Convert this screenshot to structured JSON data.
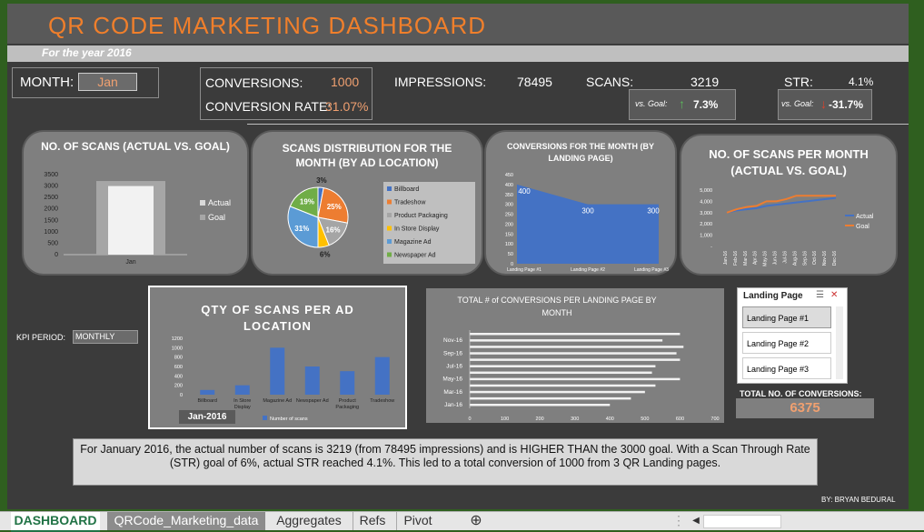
{
  "header": {
    "title": "QR CODE MARKETING DASHBOARD",
    "subtitle": "For the year 2016"
  },
  "kpis": {
    "month_label": "MONTH:",
    "month_value": "Jan",
    "conversions_label": "CONVERSIONS:",
    "conversions_value": "1000",
    "conv_rate_label": "CONVERSION RATE:",
    "conv_rate_value": "31.07%",
    "impressions_label": "IMPRESSIONS:",
    "impressions_value": "78495",
    "scans_label": "SCANS:",
    "scans_value": "3219",
    "scans_goal_label": "vs. Goal:",
    "scans_goal_value": "7.3%",
    "scans_goal_arrow": "↑",
    "str_label": "STR:",
    "str_value": "4.1%",
    "str_goal_label": "vs. Goal:",
    "str_goal_value": "-31.7%",
    "str_goal_arrow": "↓"
  },
  "colors": {
    "orange": "#f07f2b",
    "blue": "#4472c4",
    "green_up": "#5cb85c",
    "red_down": "#e0402a"
  },
  "chart_data": [
    {
      "type": "bar",
      "title": "NO. OF SCANS (ACTUAL VS. GOAL)",
      "categories": [
        "Jan"
      ],
      "series": [
        {
          "name": "Actual",
          "values": [
            3000
          ]
        },
        {
          "name": "Goal",
          "values": [
            3219
          ]
        }
      ],
      "y_ticks": [
        "3500",
        "3000",
        "2500",
        "2000",
        "1500",
        "1000",
        "500",
        "0"
      ],
      "ylim": [
        0,
        3500
      ],
      "legend": "right"
    },
    {
      "type": "pie",
      "title": "SCANS DISTRIBUTION FOR THE MONTH (BY AD LOCATION)",
      "labels": [
        "Billboard",
        "Tradeshow",
        "Product Packaging",
        "In Store Display",
        "Magazine Ad",
        "Newspaper Ad"
      ],
      "values": [
        3,
        25,
        16,
        6,
        31,
        19
      ],
      "value_labels": [
        "3%",
        "25%",
        "16%",
        "6%",
        "31%",
        "19%"
      ],
      "colors": [
        "#4472c4",
        "#ed7d31",
        "#a5a5a5",
        "#ffc000",
        "#5b9bd5",
        "#70ad47"
      ],
      "legend": "right"
    },
    {
      "type": "area",
      "title": "CONVERSIONS FOR THE MONTH  (BY LANDING PAGE)",
      "categories": [
        "Landing Page #1",
        "Landing Page #2",
        "Landing Page #3"
      ],
      "values": [
        400,
        300,
        300
      ],
      "value_labels": [
        "400",
        "300",
        "300"
      ],
      "y_ticks": [
        "450",
        "400",
        "350",
        "300",
        "250",
        "200",
        "150",
        "100",
        "50",
        "0"
      ],
      "ylim": [
        0,
        450
      ]
    },
    {
      "type": "line",
      "title": "NO. OF SCANS PER MONTH (ACTUAL VS. GOAL)",
      "categories": [
        "Jan-16",
        "Feb-16",
        "Mar-16",
        "Apr-16",
        "May-16",
        "Jun-16",
        "Jul-16",
        "Aug-16",
        "Sep-16",
        "Oct-16",
        "Nov-16",
        "Dec-16"
      ],
      "series": [
        {
          "name": "Actual",
          "values": [
            3000,
            3200,
            3300,
            3400,
            3600,
            3700,
            3800,
            3900,
            4000,
            4100,
            4200,
            4300
          ]
        },
        {
          "name": "Goal",
          "values": [
            3000,
            3300,
            3500,
            3600,
            4000,
            4000,
            4200,
            4500,
            4500,
            4500,
            4500,
            4500
          ]
        }
      ],
      "y_ticks": [
        "5,000",
        "4,000",
        "3,000",
        "2,000",
        "1,000",
        "-"
      ],
      "ylim": [
        0,
        5000
      ],
      "legend": "right"
    },
    {
      "type": "bar",
      "title": "QTY OF SCANS PER AD LOCATION",
      "categories": [
        "Billboard",
        "In Store Display",
        "Magazine Ad",
        "Newspaper Ad",
        "Product Packaging",
        "Tradeshow"
      ],
      "values": [
        100,
        200,
        1000,
        600,
        500,
        800
      ],
      "series_name": "Number of scans",
      "y_ticks": [
        "1200",
        "1000",
        "800",
        "600",
        "400",
        "200",
        "0"
      ],
      "ylim": [
        0,
        1200
      ],
      "filter_value": "Jan-2016"
    },
    {
      "type": "bar",
      "title": "TOTAL # of CONVERSIONS PER LANDING PAGE BY MONTH",
      "orientation": "horizontal",
      "categories": [
        "Jan-16",
        "Feb-16",
        "Mar-16",
        "Apr-16",
        "May-16",
        "Jun-16",
        "Jul-16",
        "Aug-16",
        "Sep-16",
        "Oct-16",
        "Nov-16",
        "Dec-16"
      ],
      "values": [
        400,
        460,
        500,
        530,
        600,
        520,
        530,
        600,
        590,
        610,
        550,
        600
      ],
      "y_tick_labels": [
        "Nov-16",
        "Sep-16",
        "Jul-16",
        "May-16",
        "Mar-16",
        "Jan-16"
      ],
      "x_ticks": [
        "0",
        "100",
        "200",
        "300",
        "400",
        "500",
        "600",
        "700"
      ],
      "xlim": [
        0,
        700
      ]
    }
  ],
  "kpi_period": {
    "label": "KPI PERIOD:",
    "value": "MONTHLY"
  },
  "slicer": {
    "title": "Landing Page",
    "items": [
      "Landing Page #1",
      "Landing Page #2",
      "Landing Page #3"
    ]
  },
  "total_conversions": {
    "label": "TOTAL NO. OF CONVERSIONS:",
    "value": "6375"
  },
  "summary": "For January 2016, the actual number of scans is 3219 (from 78495 impressions) and is HIGHER THAN the 3000 goal. With a Scan Through Rate (STR) goal of 6%, actual STR reached 4.1%. This led to a total conversion of 1000 from 3 QR Landing pages.",
  "author": "BY: BRYAN BEDURAL",
  "tabs": [
    "DASHBOARD",
    "QRCode_Marketing_data",
    "Aggregates",
    "Refs",
    "Pivot"
  ]
}
